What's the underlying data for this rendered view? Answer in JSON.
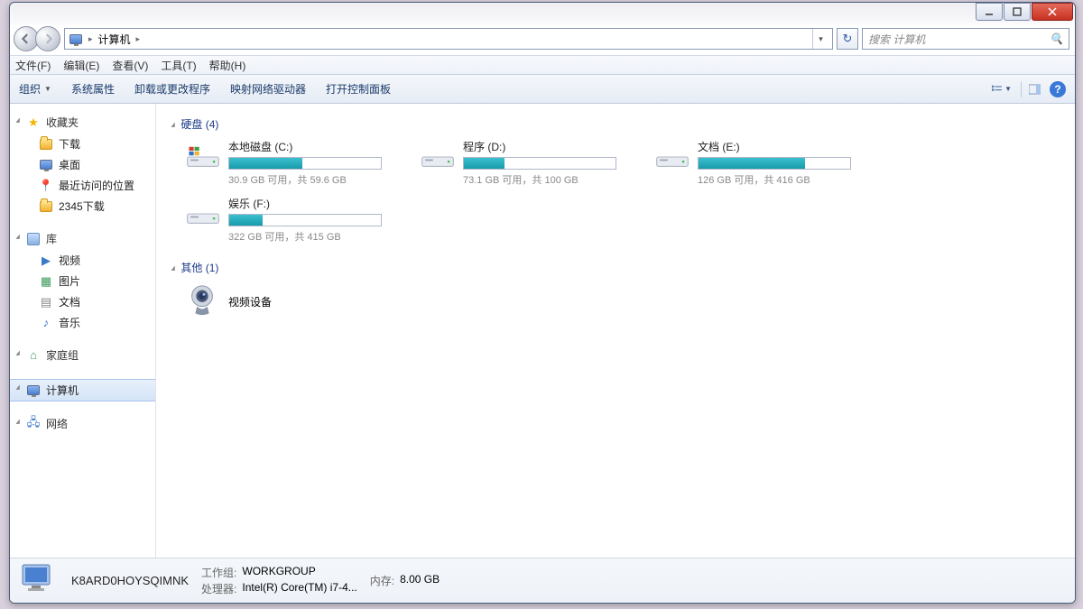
{
  "breadcrumb": {
    "root_label": "计算机"
  },
  "search": {
    "placeholder": "搜索 计算机"
  },
  "menu": {
    "file": "文件(F)",
    "edit": "编辑(E)",
    "view": "查看(V)",
    "tools": "工具(T)",
    "help": "帮助(H)"
  },
  "toolbar": {
    "organize": "组织",
    "sysprops": "系统属性",
    "uninstall": "卸载或更改程序",
    "mapdrive": "映射网络驱动器",
    "ctrlpanel": "打开控制面板"
  },
  "sidebar": {
    "favorites": {
      "label": "收藏夹",
      "items": [
        {
          "label": "下载",
          "icon": "folder"
        },
        {
          "label": "桌面",
          "icon": "desktop"
        },
        {
          "label": "最近访问的位置",
          "icon": "recent"
        },
        {
          "label": "2345下载",
          "icon": "folder"
        }
      ]
    },
    "libraries": {
      "label": "库",
      "items": [
        {
          "label": "视频",
          "icon": "video"
        },
        {
          "label": "图片",
          "icon": "picture"
        },
        {
          "label": "文档",
          "icon": "doc"
        },
        {
          "label": "音乐",
          "icon": "music"
        }
      ]
    },
    "homegroup": {
      "label": "家庭组"
    },
    "computer": {
      "label": "计算机"
    },
    "network": {
      "label": "网络"
    }
  },
  "groups": {
    "drives_label": "硬盘 (4)",
    "other_label": "其他 (1)"
  },
  "drives": [
    {
      "name": "本地磁盘 (C:)",
      "free": "30.9 GB 可用，共 59.6 GB",
      "pct": 48,
      "system": true
    },
    {
      "name": "程序 (D:)",
      "free": "73.1 GB 可用，共 100 GB",
      "pct": 27
    },
    {
      "name": "文档 (E:)",
      "free": "126 GB 可用，共 416 GB",
      "pct": 70
    },
    {
      "name": "娱乐 (F:)",
      "free": "322 GB 可用，共 415 GB",
      "pct": 22
    }
  ],
  "other_device": {
    "name": "视频设备"
  },
  "status": {
    "computer_name": "K8ARD0HOYSQIMNK",
    "workgroup_lbl": "工作组:",
    "workgroup_val": "WORKGROUP",
    "cpu_lbl": "处理器:",
    "cpu_val": "Intel(R) Core(TM) i7-4...",
    "mem_lbl": "内存:",
    "mem_val": "8.00 GB"
  }
}
